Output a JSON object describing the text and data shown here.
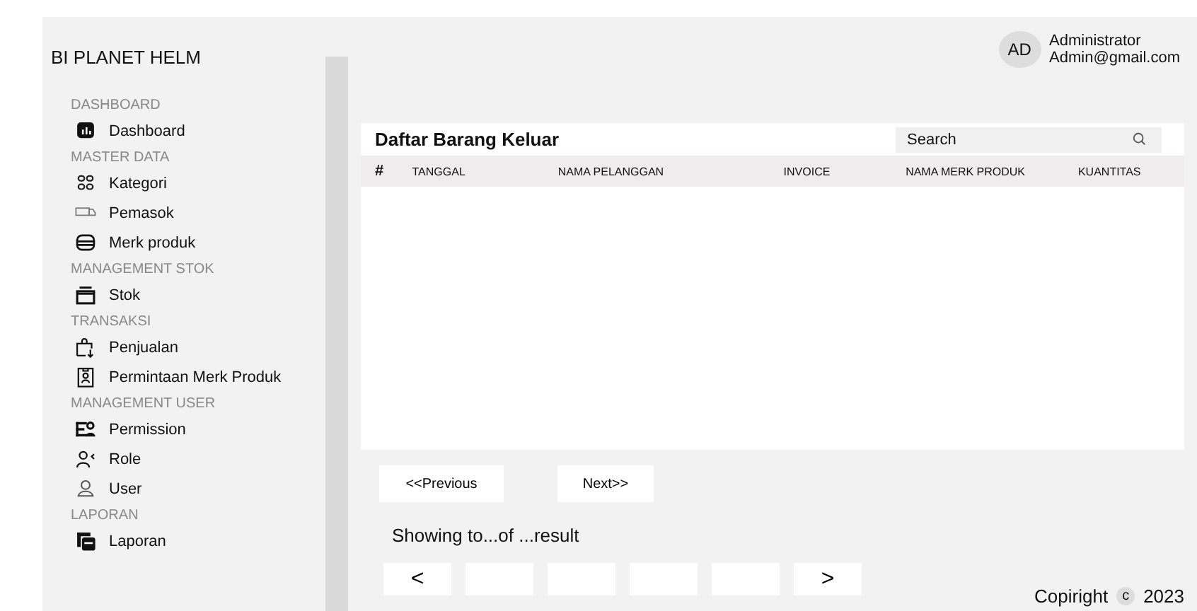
{
  "brand": "BI PLANET HELM",
  "user": {
    "initials": "AD",
    "name": "Administrator",
    "email": "Admin@gmail.com"
  },
  "sidebar": [
    {
      "heading": "DASHBOARD",
      "items": [
        "Dashboard"
      ]
    },
    {
      "heading": "MASTER DATA",
      "items": [
        "Kategori",
        "Pemasok",
        "Merk produk"
      ]
    },
    {
      "heading": "MANAGEMENT STOK",
      "items": [
        "Stok"
      ]
    },
    {
      "heading": "TRANSAKSI",
      "items": [
        "Penjualan",
        "Permintaan Merk Produk"
      ]
    },
    {
      "heading": "MANAGEMENT USER",
      "items": [
        "Permission",
        "Role",
        "User"
      ]
    },
    {
      "heading": "LAPORAN",
      "items": [
        "Laporan"
      ]
    }
  ],
  "panel": {
    "title": "Daftar Barang Keluar",
    "search": {
      "placeholder": "Search"
    },
    "columns": [
      "#",
      "TANGGAL",
      "NAMA PELANGGAN",
      "INVOICE",
      "NAMA MERK PRODUK",
      "KUANTITAS"
    ]
  },
  "nav_buttons": [
    "<<Previous",
    "Next>>"
  ],
  "summary": "Showing to...of ...result",
  "pages": [
    {
      "kind": "arrow",
      "label": "<"
    },
    {
      "kind": "blank"
    },
    {
      "kind": "blank"
    },
    {
      "kind": "blank"
    },
    {
      "kind": "blank"
    },
    {
      "kind": "arrow",
      "label": ">"
    }
  ],
  "footer": {
    "text": "Copiright",
    "mark": "c",
    "year": "2023"
  }
}
